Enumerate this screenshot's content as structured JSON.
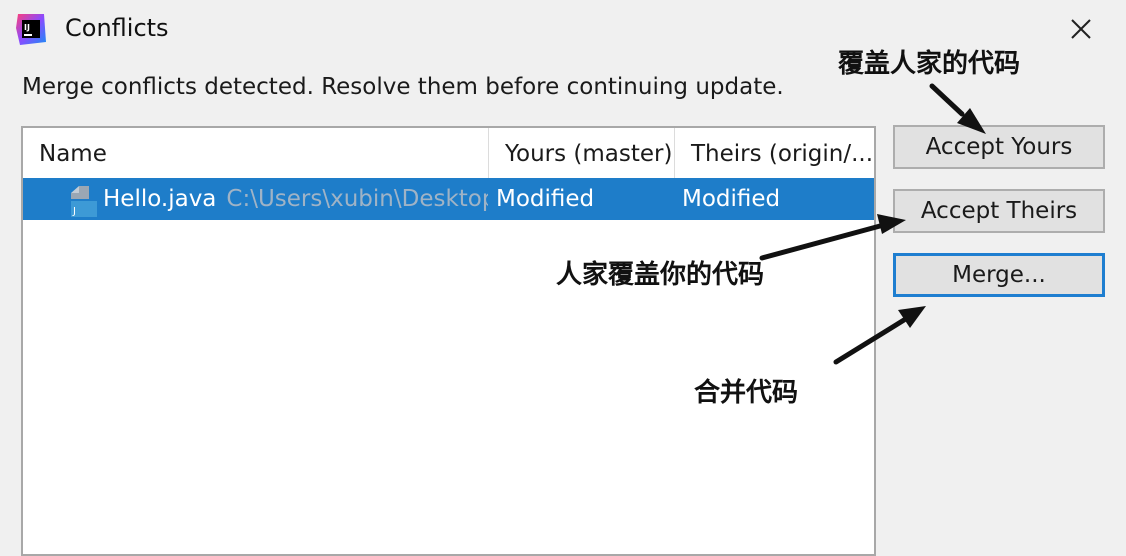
{
  "window": {
    "title": "Conflicts",
    "app_icon": "intellij-idea-icon",
    "close_icon": "close-icon"
  },
  "message": "Merge conflicts detected. Resolve them before continuing update.",
  "table": {
    "columns": [
      "Name",
      "Yours (master)",
      "Theirs (origin/..."
    ],
    "rows": [
      {
        "file_icon": "java-file-icon",
        "name": "Hello.java",
        "path": "C:\\Users\\xubin\\Desktop",
        "yours": "Modified",
        "theirs": "Modified",
        "selected": true
      }
    ]
  },
  "buttons": {
    "accept_yours": "Accept Yours",
    "accept_theirs": "Accept Theirs",
    "merge": "Merge..."
  },
  "annotations": {
    "accept_yours_note": "覆盖人家的代码",
    "accept_theirs_note": "人家覆盖你的代码",
    "merge_note": "合并代码"
  },
  "colors": {
    "selection": "#1e7dc9",
    "focus_border": "#1e7ed0",
    "background": "#f0f0f0"
  }
}
